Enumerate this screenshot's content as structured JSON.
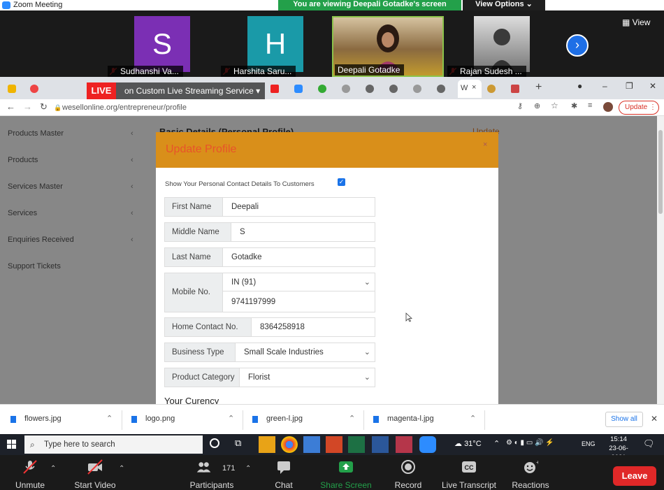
{
  "zoom": {
    "window_title": "Zoom Meeting",
    "viewing_banner": "You are viewing Deepali Gotadke's screen",
    "view_options": "View Options",
    "view_button": "View",
    "participants": [
      {
        "name": "Sudhanshi Va...",
        "initial": "S",
        "color": "#7b2fb4"
      },
      {
        "name": "Harshita Saru...",
        "initial": "H",
        "color": "#1a9aa8"
      },
      {
        "name": "Deepali Gotadke",
        "initial": "",
        "color": "#8a6a40"
      },
      {
        "name": "Rajan Sudesh ...",
        "initial": "",
        "color": "#777777"
      }
    ]
  },
  "browser": {
    "live_badge": "LIVE",
    "stream_label": "on Custom Live Streaming Service",
    "url": "wesellonline.org/entrepreneur/profile",
    "update_chip": "Update",
    "active_tab": "W"
  },
  "page": {
    "sidebar": [
      {
        "label": "Products Master"
      },
      {
        "label": "Products"
      },
      {
        "label": "Services Master"
      },
      {
        "label": "Services"
      },
      {
        "label": "Enquiries Received"
      },
      {
        "label": "Support Tickets"
      }
    ],
    "bg_heading": "Basic Details (Personal Profile)",
    "bg_update": "Update"
  },
  "modal": {
    "title": "Update Profile",
    "close": "×",
    "show_contact_label": "Show Your Personal Contact Details To Customers",
    "show_contact_checked": true,
    "fields": {
      "first_name_label": "First Name",
      "first_name": "Deepali",
      "middle_name_label": "Middle Name",
      "middle_name": "S",
      "last_name_label": "Last Name",
      "last_name": "Gotadke",
      "mobile_label": "Mobile No.",
      "mobile_country": "IN (91)",
      "mobile_number": "9741197999",
      "home_contact_label": "Home Contact No.",
      "home_contact": "8364258918",
      "business_type_label": "Business Type",
      "business_type": "Small Scale Industries",
      "product_category_label": "Product Category",
      "product_category": "Florist"
    },
    "currency_heading": "Your Curency"
  },
  "downloads": {
    "files": [
      "flowers.jpg",
      "logo.png",
      "green-l.jpg",
      "magenta-l.jpg"
    ],
    "show_all": "Show all"
  },
  "taskbar": {
    "search_placeholder": "Type here to search",
    "temperature": "31°C",
    "language": "ENG",
    "time": "15:14",
    "date": "23-06-2021"
  },
  "controls": {
    "unmute": "Unmute",
    "start_video": "Start Video",
    "participants": "Participants",
    "participant_count": "171",
    "chat": "Chat",
    "share_screen": "Share Screen",
    "record": "Record",
    "live_transcript": "Live Transcript",
    "reactions": "Reactions",
    "leave": "Leave",
    "share_color": "#23a04a",
    "leave_color": "#e02828"
  }
}
